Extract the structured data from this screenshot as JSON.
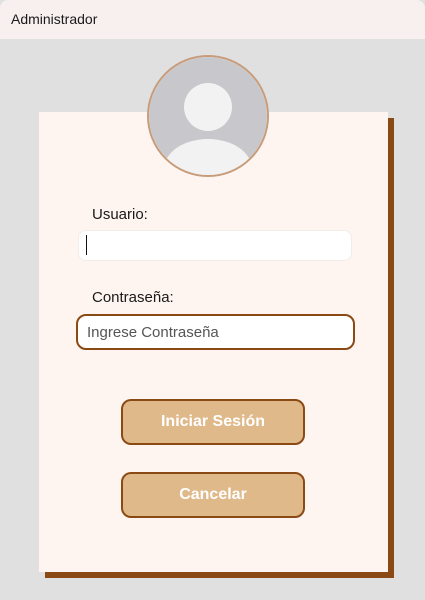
{
  "window": {
    "title": "Administrador"
  },
  "login_form": {
    "avatar_icon": "user-avatar-icon",
    "username_label": "Usuario:",
    "username_value": "",
    "password_label": "Contraseña:",
    "password_placeholder": "Ingrese Contraseña",
    "login_button": "Iniciar Sesión",
    "cancel_button": "Cancelar"
  },
  "colors": {
    "accent_brown": "#8b4a14",
    "button_fill": "#e0b98a",
    "card_background": "#fff5f0",
    "window_background": "#e0e0e0"
  }
}
